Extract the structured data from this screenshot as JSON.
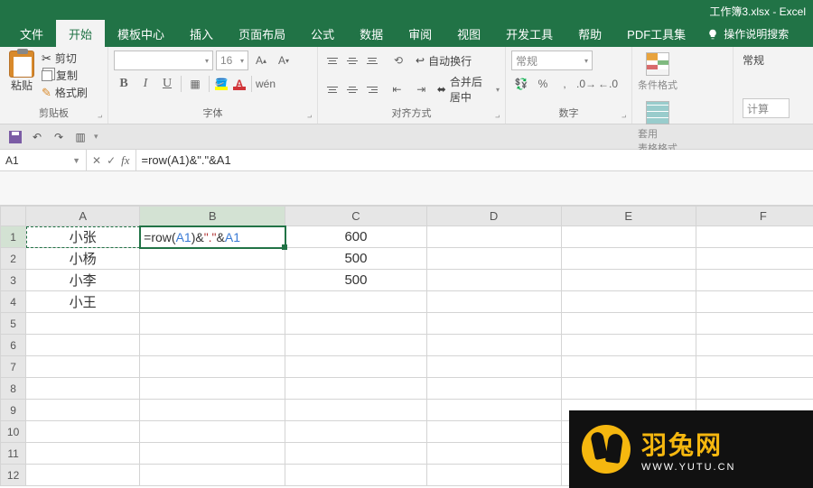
{
  "title": "工作簿3.xlsx - Excel",
  "tabs": {
    "file": "文件",
    "home": "开始",
    "template": "模板中心",
    "insert": "插入",
    "layout": "页面布局",
    "formulas": "公式",
    "data": "数据",
    "review": "审阅",
    "view": "视图",
    "dev": "开发工具",
    "help": "帮助",
    "pdf": "PDF工具集",
    "tell_me": "操作说明搜索"
  },
  "ribbon": {
    "clipboard": {
      "label": "剪贴板",
      "paste": "粘贴",
      "cut": "剪切",
      "copy": "复制",
      "painter": "格式刷"
    },
    "font": {
      "label": "字体",
      "name_placeholder": "",
      "size_placeholder": "16",
      "wen": "wén"
    },
    "align": {
      "label": "对齐方式",
      "wrap": "自动换行",
      "merge": "合并后居中"
    },
    "number": {
      "label": "数字",
      "general": "常规"
    },
    "styles": {
      "cond_fmt": "条件格式",
      "table_fmt": "套用\n表格格式"
    },
    "calc": {
      "label": "常规",
      "calc": "计算"
    }
  },
  "namebox": "A1",
  "formula": "=row(A1)&\".\"&A1",
  "columns": [
    "A",
    "B",
    "C",
    "D",
    "E",
    "F"
  ],
  "rows": [
    1,
    2,
    3,
    4,
    5,
    6,
    7,
    8,
    9,
    10,
    11,
    12
  ],
  "cells": {
    "A1": "小张",
    "A2": "小杨",
    "A3": "小李",
    "A4": "小王",
    "B1_display": {
      "pre": "=row(",
      "r1": "A1",
      "mid": ")&",
      "q": "\".\"",
      "amp": "&",
      "r2": "A1"
    },
    "C1": "600",
    "C2": "500",
    "C3": "500"
  },
  "watermark": {
    "cn": "羽兔网",
    "en": "WWW.YUTU.CN"
  }
}
